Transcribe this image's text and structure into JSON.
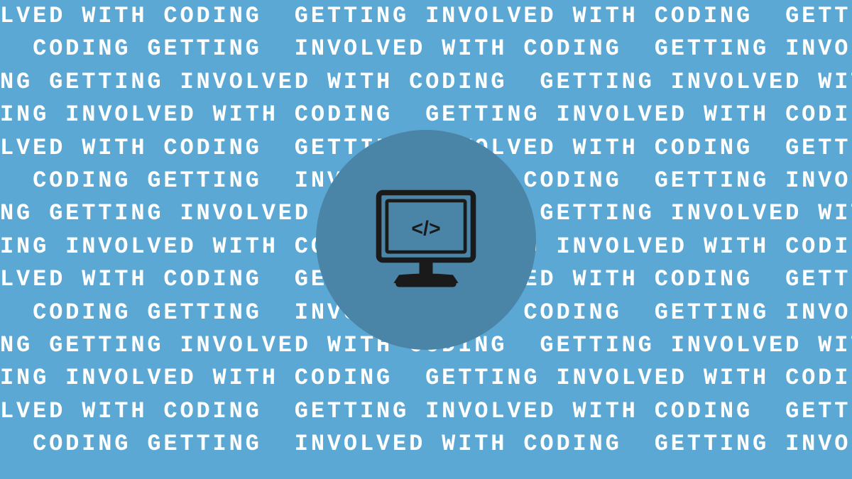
{
  "background": {
    "color": "#5ba8d4",
    "circle_color": "#4a85a8",
    "text_phrase": "GETTING INVOLVED WITH CODING",
    "text_color": "#ffffff",
    "rows": [
      "LVED WITH CODING GETTING INVOLVED WITH CODING GETTING IN",
      "  CODING GETTING INVOLVED WITH CODING GETTING INVOLVED",
      "NG GETTING INVOLVED WITH CODING GETTING INVOLVED WITH",
      "ING INVOLVED WITH CODING GETTING INVOLVED WITH CODING G",
      "LVED WITH CODING GETTING INVOLVED WITH CODING GETTING IN",
      "  CODING GETTING INVOLVED WITH CODING GETTING INVOLVED",
      "NG GETTING INVOLVED WITH CODING GETTING INVOLVED WITH",
      "ING INVOLVED WITH CODING GETTING INVOLVED WITH CODING G",
      "LVED WITH CODING GETTING INVOLVED WITH CODING GETTING IN",
      "  CODING GETTING INVOLVED WITH CODING GETTING INVOLVED",
      "NG GETTING INVOLVED WITH CODING GETTING INVOLVED WITH",
      "ING INVOLVED WITH CODING GETTING INVOLVED WITH CODING G",
      "LVED WITH CODING GETTING INVOLVED WITH CODING GETTING IN",
      "  CODING GETTING INVOLVED WITH CODING GETTING INVOLVED"
    ]
  },
  "icon": {
    "alt": "Computer monitor with code symbol",
    "aria_label": "coding-monitor-icon"
  }
}
